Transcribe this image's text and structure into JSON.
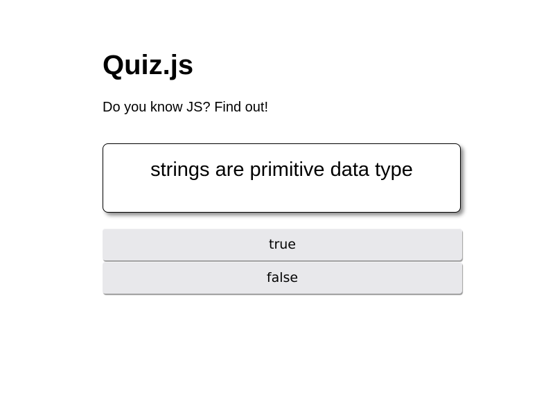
{
  "header": {
    "title": "Quiz.js",
    "subtitle": "Do you know JS? Find out!"
  },
  "question": {
    "text": "strings are primitive data type"
  },
  "answers": [
    {
      "label": "true"
    },
    {
      "label": "false"
    }
  ]
}
